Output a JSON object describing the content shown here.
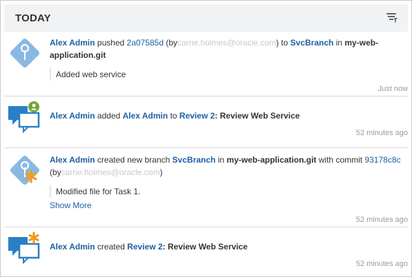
{
  "header": {
    "title": "TODAY",
    "filter_icon": "filter-icon"
  },
  "entries": [
    {
      "actor": "Alex Admin",
      "verb": "pushed",
      "commit": "2a07585d",
      "by_open": "(by",
      "email_redacted": "carrie.holmes@oracle.com",
      "by_close": ")",
      "to": "to",
      "branch": "SvcBranch",
      "in": "in",
      "repo": "my-web-application.git",
      "message": "Added web service",
      "time": "Just now"
    },
    {
      "actor": "Alex Admin",
      "verb": "added",
      "target": "Alex Admin",
      "to": "to",
      "review": "Review 2",
      "review_title": ": Review Web Service",
      "time": "52 minutes ago"
    },
    {
      "actor": "Alex Admin",
      "verb": "created new branch",
      "branch": "SvcBranch",
      "in": "in",
      "repo": "my-web-application.git",
      "with_commit": "with commit",
      "commit": "93178c8c",
      "by_open": "(by",
      "email_redacted": "carrie.holmes@oracle.com",
      "by_close": ")",
      "message": "Modified file for Task 1.",
      "show_more": "Show More",
      "time": "52 minutes ago"
    },
    {
      "actor": "Alex Admin",
      "verb": "created",
      "review": "Review 2",
      "review_title": ": Review Web Service",
      "time": "52 minutes ago"
    }
  ],
  "colors": {
    "link": "#1e5ea3",
    "diamond": "#8ab8e3",
    "bubble": "#2a7fc6",
    "badge_green": "#6da63a",
    "star_orange": "#f29a1a"
  }
}
